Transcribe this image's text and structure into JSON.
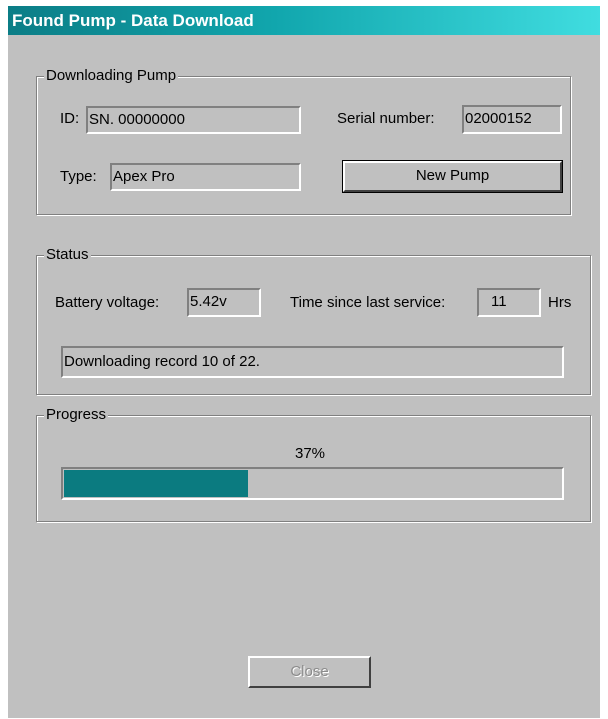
{
  "window": {
    "title": "Found Pump - Data Download"
  },
  "pump_group": {
    "label": "Downloading Pump",
    "id_label": "ID:",
    "id_value": "SN. 00000000",
    "serial_label": "Serial number:",
    "serial_value": "02000152",
    "type_label": "Type:",
    "type_value": "Apex Pro",
    "new_pump_button": "New Pump"
  },
  "status_group": {
    "label": "Status",
    "battery_label": "Battery voltage:",
    "battery_value": "5.42v",
    "service_label": "Time since last service:",
    "service_value": "11",
    "service_unit": "Hrs",
    "message": "Downloading record 10 of 22."
  },
  "progress_group": {
    "label": "Progress",
    "percent_text": "37%",
    "percent": 37,
    "fill_color": "#0b7b80"
  },
  "close_button": {
    "label": "Close",
    "disabled": true
  }
}
